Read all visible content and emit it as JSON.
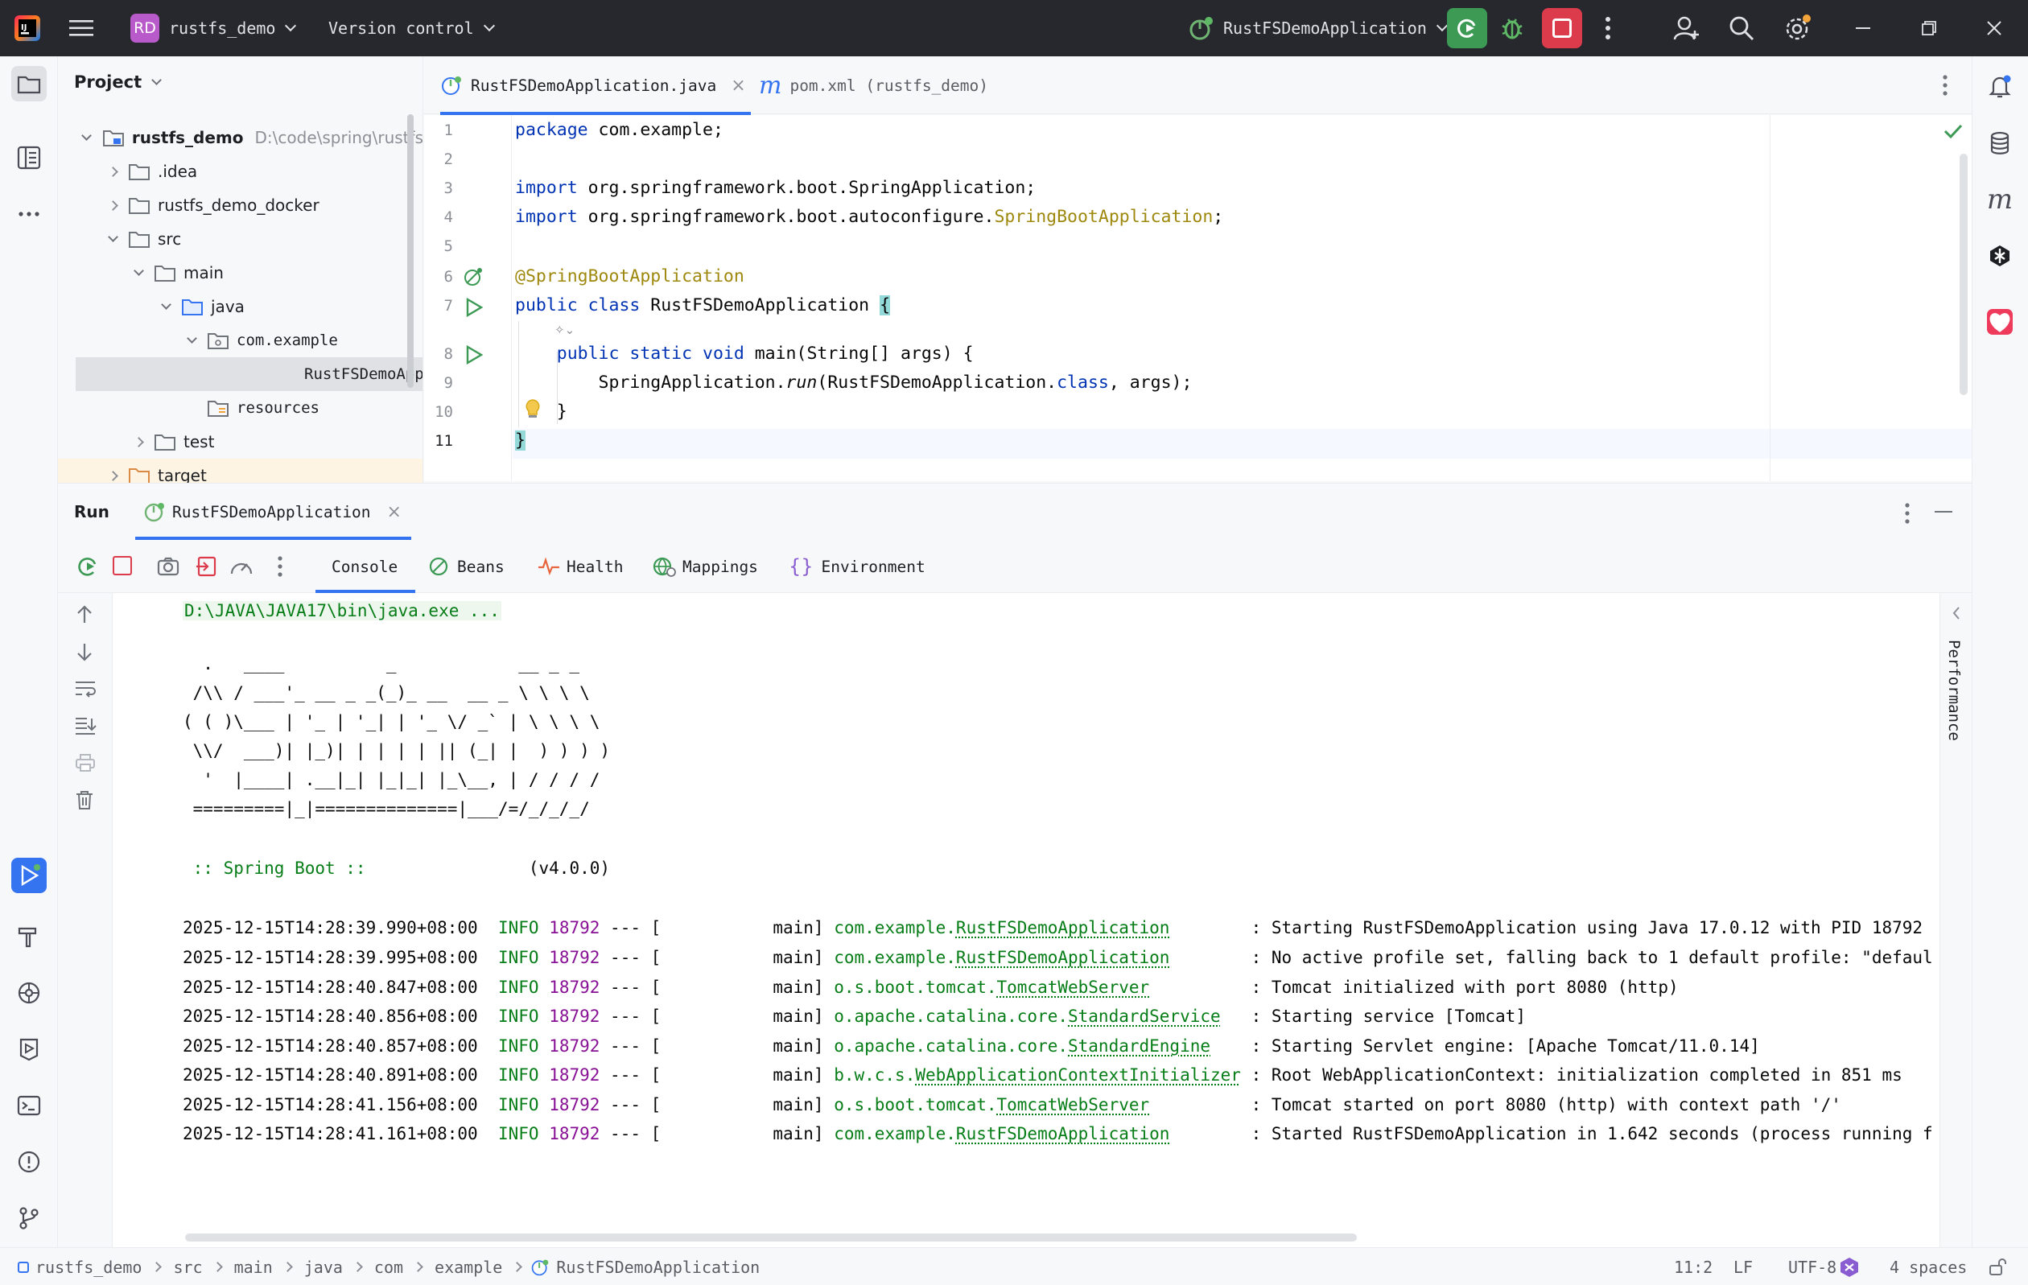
{
  "titlebar": {
    "project_badge": "RD",
    "project_name": "rustfs_demo",
    "vcs_label": "Version control",
    "run_config": "RustFSDemoApplication"
  },
  "project": {
    "header": "Project",
    "tree": [
      {
        "label": "rustfs_demo",
        "path_hint": "D:\\code\\spring\\rustfs"
      },
      {
        "label": ".idea"
      },
      {
        "label": "rustfs_demo_docker"
      },
      {
        "label": "src"
      },
      {
        "label": "main"
      },
      {
        "label": "java"
      },
      {
        "label": "com.example"
      },
      {
        "label": "RustFSDemoApplicat"
      },
      {
        "label": "resources"
      },
      {
        "label": "test"
      },
      {
        "label": "target"
      }
    ]
  },
  "editor": {
    "tabs": [
      {
        "label": "RustFSDemoApplication.java"
      },
      {
        "label": "pom.xml (rustfs_demo)"
      }
    ],
    "line_numbers": [
      "1",
      "2",
      "3",
      "4",
      "5",
      "6",
      "7",
      "8",
      "9",
      "10",
      "11"
    ],
    "code": {
      "l1_kw": "package",
      "l1_rest": " com.example;",
      "l3_kw": "import",
      "l3_rest": " org.springframework.boot.SpringApplication;",
      "l4_kw": "import",
      "l4_rest": " org.springframework.boot.autoconfigure.",
      "l4_ann": "SpringBootApplication",
      "l4_end": ";",
      "l6_ann": "@SpringBootApplication",
      "l7_kw": "public class",
      "l7_rest": " RustFSDemoApplication ",
      "l7_brace": "{",
      "l8_kw": "    public static void",
      "l8_rest": " main(String[] args) {",
      "l9_a": "        SpringApplication.",
      "l9_run": "run",
      "l9_b": "(RustFSDemoApplication.",
      "l9_cls": "class",
      "l9_c": ", args);",
      "l10": "    }",
      "l11": "}"
    }
  },
  "run": {
    "title": "Run",
    "tab": "RustFSDemoApplication",
    "subtabs": [
      "Console",
      "Beans",
      "Health",
      "Mappings",
      "Environment"
    ],
    "side_label": "Performance"
  },
  "console": {
    "cmd": "D:\\JAVA\\JAVA17\\bin\\java.exe ...",
    "banner": [
      "  .   ____          _            __ _ _",
      " /\\\\ / ___'_ __ _ _(_)_ __  __ _ \\ \\ \\ \\",
      "( ( )\\___ | '_ | '_| | '_ \\/ _` | \\ \\ \\ \\",
      " \\\\/  ___)| |_)| | | | | || (_| |  ) ) ) )",
      "  '  |____| .__|_| |_|_| |_\\__, | / / / /",
      " =========|_|==============|___/=/_/_/_/"
    ],
    "spring_label": " :: Spring Boot ::",
    "spring_version": "                (v4.0.0)",
    "logs": [
      {
        "ts": "2025-12-15T14:28:39.990+08:00",
        "level": "INFO",
        "pid": "18792",
        "sep": " --- [           main] ",
        "pkg": "com.example.",
        "cls": "RustFSDemoApplication",
        "pad": "        ",
        "msg": ": Starting RustFSDemoApplication using Java 17.0.12 with PID 18792"
      },
      {
        "ts": "2025-12-15T14:28:39.995+08:00",
        "level": "INFO",
        "pid": "18792",
        "sep": " --- [           main] ",
        "pkg": "com.example.",
        "cls": "RustFSDemoApplication",
        "pad": "        ",
        "msg": ": No active profile set, falling back to 1 default profile: \"defaul"
      },
      {
        "ts": "2025-12-15T14:28:40.847+08:00",
        "level": "INFO",
        "pid": "18792",
        "sep": " --- [           main] ",
        "pkg": "o.s.boot.tomcat.",
        "cls": "TomcatWebServer",
        "pad": "          ",
        "msg": ": Tomcat initialized with port 8080 (http)"
      },
      {
        "ts": "2025-12-15T14:28:40.856+08:00",
        "level": "INFO",
        "pid": "18792",
        "sep": " --- [           main] ",
        "pkg": "o.apache.catalina.core.",
        "cls": "StandardService",
        "pad": "   ",
        "msg": ": Starting service [Tomcat]"
      },
      {
        "ts": "2025-12-15T14:28:40.857+08:00",
        "level": "INFO",
        "pid": "18792",
        "sep": " --- [           main] ",
        "pkg": "o.apache.catalina.core.",
        "cls": "StandardEngine",
        "pad": "    ",
        "msg": ": Starting Servlet engine: [Apache Tomcat/11.0.14]"
      },
      {
        "ts": "2025-12-15T14:28:40.891+08:00",
        "level": "INFO",
        "pid": "18792",
        "sep": " --- [           main] ",
        "pkg": "b.w.c.s.",
        "cls": "WebApplicationContextInitializer",
        "pad": " ",
        "msg": ": Root WebApplicationContext: initialization completed in 851 ms"
      },
      {
        "ts": "2025-12-15T14:28:41.156+08:00",
        "level": "INFO",
        "pid": "18792",
        "sep": " --- [           main] ",
        "pkg": "o.s.boot.tomcat.",
        "cls": "TomcatWebServer",
        "pad": "          ",
        "msg": ": Tomcat started on port 8080 (http) with context path '/'"
      },
      {
        "ts": "2025-12-15T14:28:41.161+08:00",
        "level": "INFO",
        "pid": "18792",
        "sep": " --- [           main] ",
        "pkg": "com.example.",
        "cls": "RustFSDemoApplication",
        "pad": "        ",
        "msg": ": Started RustFSDemoApplication in 1.642 seconds (process running f"
      }
    ]
  },
  "statusbar": {
    "breadcrumbs": [
      "rustfs_demo",
      "src",
      "main",
      "java",
      "com",
      "example",
      "RustFSDemoApplication"
    ],
    "position": "11:2",
    "line_sep": "LF",
    "encoding": "UTF-8",
    "indent": "4 spaces"
  },
  "colors": {
    "accent": "#3574f0",
    "run_green": "#3c9a55",
    "stop_red": "#db3b4b",
    "titlebar": "#27282e"
  }
}
